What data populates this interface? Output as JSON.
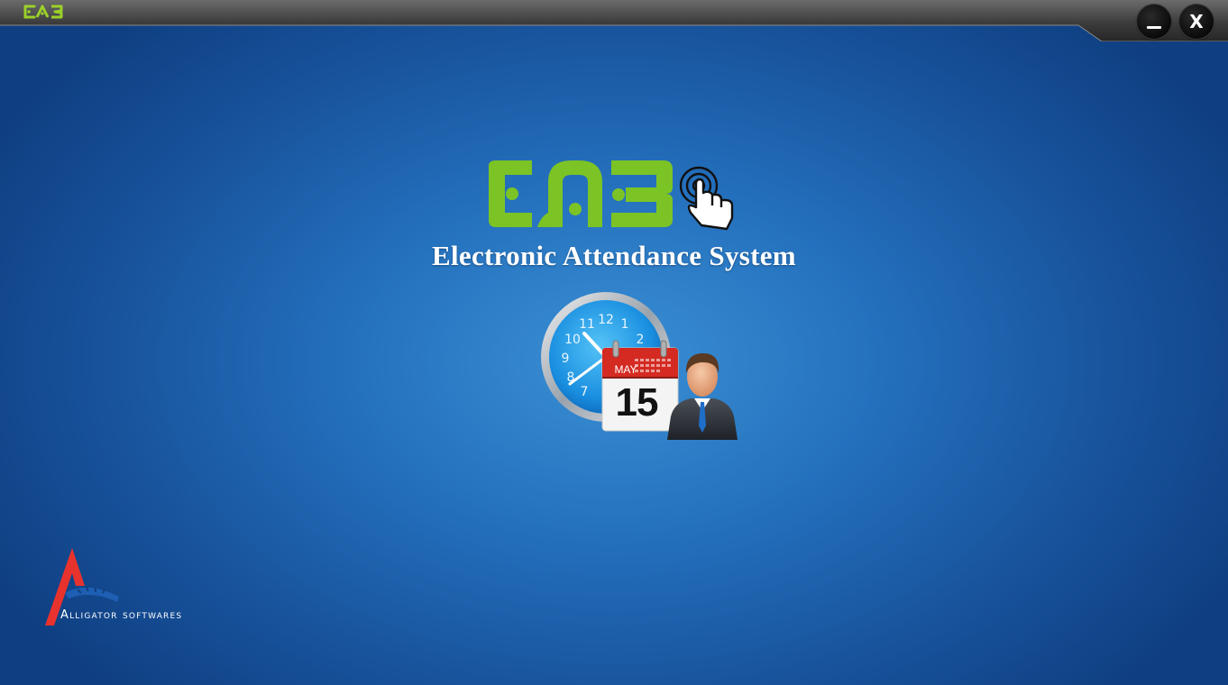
{
  "window": {
    "logo_text": "EAS",
    "minimize_icon": "minimize-icon",
    "close_icon": "close-icon",
    "close_glyph": "X"
  },
  "splash": {
    "title": "Electronic Attendance System",
    "hero_icons": [
      "clock-icon",
      "calendar-icon",
      "businessman-icon"
    ],
    "calendar_month": "MAY",
    "calendar_day": "15"
  },
  "vendor": {
    "name": "Alligator softwares"
  },
  "colors": {
    "brand_green": "#7cc326",
    "background": "#2470bd",
    "title_text": "#ffffff",
    "calendar_red": "#d42a22"
  }
}
